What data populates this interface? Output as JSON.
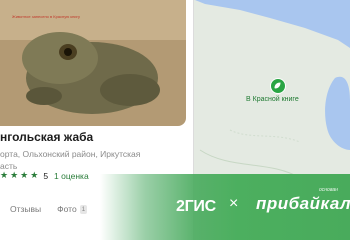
{
  "map": {
    "poi_label": "В Красной книге",
    "poi_icon": "leaf-icon",
    "marker_icon": "location-pin-icon",
    "water_color": "#a9c6ef",
    "marker_color": "#1a73e8"
  },
  "card": {
    "photo_caption": "Животное занесено в Красную книгу",
    "title": "нгольская жаба",
    "address": "орта, Ольхонский район, Иркутская\nасть",
    "rating": {
      "stars": 4,
      "value": "5",
      "count_label": "1 оценка"
    },
    "tabs": {
      "reviews": "Отзывы",
      "photo": "Фото",
      "photo_count": "1"
    }
  },
  "banner": {
    "brand_left": "2ГИС",
    "separator": "×",
    "brand_right": "прибайкал",
    "brand_right_tag": "основан",
    "color": "#4caf5f"
  }
}
